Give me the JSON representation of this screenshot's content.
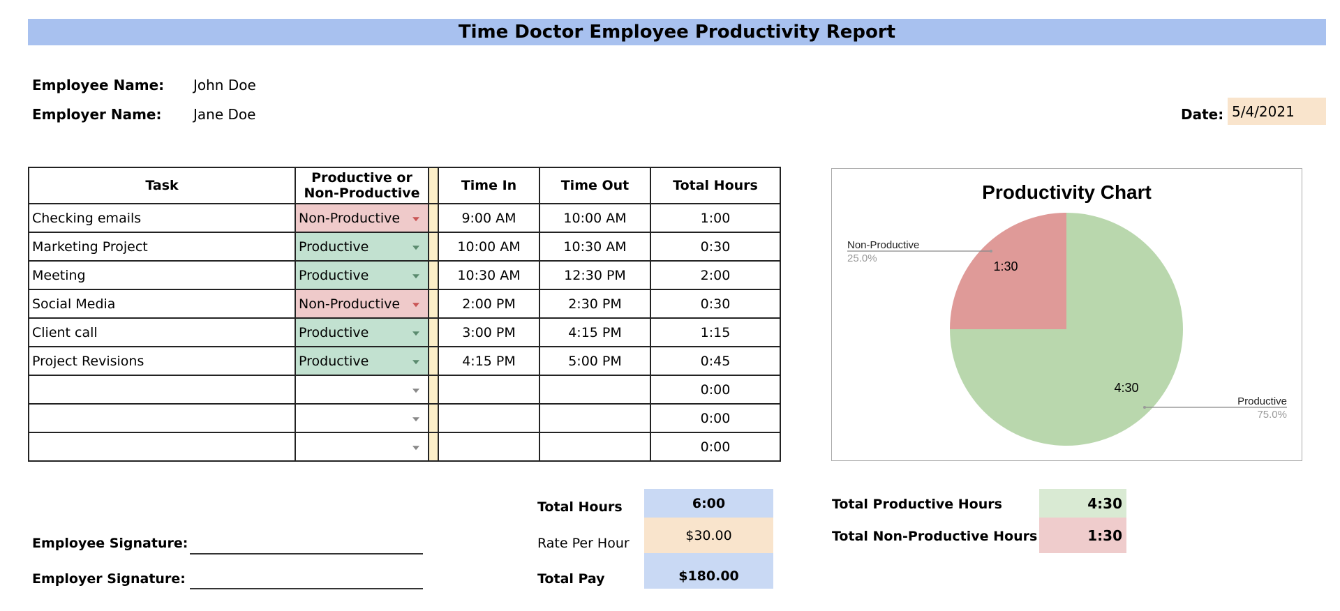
{
  "title": "Time Doctor Employee Productivity Report",
  "employee": {
    "label": "Employee Name:",
    "value": "John Doe"
  },
  "employer": {
    "label": "Employer Name:",
    "value": "Jane Doe"
  },
  "date": {
    "label": "Date:",
    "value": "5/4/2021"
  },
  "table": {
    "headers": {
      "task": "Task",
      "prod_line1": "Productive or",
      "prod_line2": "Non-Productive",
      "time_in": "Time In",
      "time_out": "Time Out",
      "total": "Total Hours"
    },
    "rows": [
      {
        "task": "Checking emails",
        "status": "Non-Productive",
        "kind": "N",
        "in": "9:00 AM",
        "out": "10:00 AM",
        "total": "1:00"
      },
      {
        "task": "Marketing Project",
        "status": "Productive",
        "kind": "P",
        "in": "10:00 AM",
        "out": "10:30 AM",
        "total": "0:30"
      },
      {
        "task": "Meeting",
        "status": "Productive",
        "kind": "P",
        "in": "10:30 AM",
        "out": "12:30 PM",
        "total": "2:00"
      },
      {
        "task": "Social Media",
        "status": "Non-Productive",
        "kind": "N",
        "in": "2:00 PM",
        "out": "2:30 PM",
        "total": "0:30"
      },
      {
        "task": "Client call",
        "status": "Productive",
        "kind": "P",
        "in": "3:00 PM",
        "out": "4:15 PM",
        "total": "1:15"
      },
      {
        "task": "Project Revisions",
        "status": "Productive",
        "kind": "P",
        "in": "4:15 PM",
        "out": "5:00 PM",
        "total": "0:45"
      },
      {
        "task": "",
        "status": "",
        "kind": "",
        "in": "",
        "out": "",
        "total": "0:00"
      },
      {
        "task": "",
        "status": "",
        "kind": "",
        "in": "",
        "out": "",
        "total": "0:00"
      },
      {
        "task": "",
        "status": "",
        "kind": "",
        "in": "",
        "out": "",
        "total": "0:00"
      }
    ]
  },
  "summary": {
    "total_hours_label": "Total Hours",
    "total_hours": "6:00",
    "rate_label": "Rate Per Hour",
    "rate": "$30.00",
    "total_pay_label": "Total Pay",
    "total_pay": "$180.00"
  },
  "prod_summary": {
    "productive_label": "Total Productive Hours",
    "productive": "4:30",
    "nonproductive_label": "Total Non-Productive Hours",
    "nonproductive": "1:30"
  },
  "signatures": {
    "employee": "Employee Signature:",
    "employer": "Employer Signature:"
  },
  "colors": {
    "productive": "#b9d7ad",
    "nonproductive": "#df9a98",
    "header": "#a8c1ef"
  },
  "chart_data": {
    "type": "pie",
    "title": "Productivity Chart",
    "categories": [
      "Productive",
      "Non-Productive"
    ],
    "values": [
      4.5,
      1.5
    ],
    "value_labels": [
      "4:30",
      "1:30"
    ],
    "percent_labels": [
      "75.0%",
      "25.0%"
    ],
    "colors": [
      "#b9d7ad",
      "#df9a98"
    ],
    "legend": "labels-outside"
  }
}
